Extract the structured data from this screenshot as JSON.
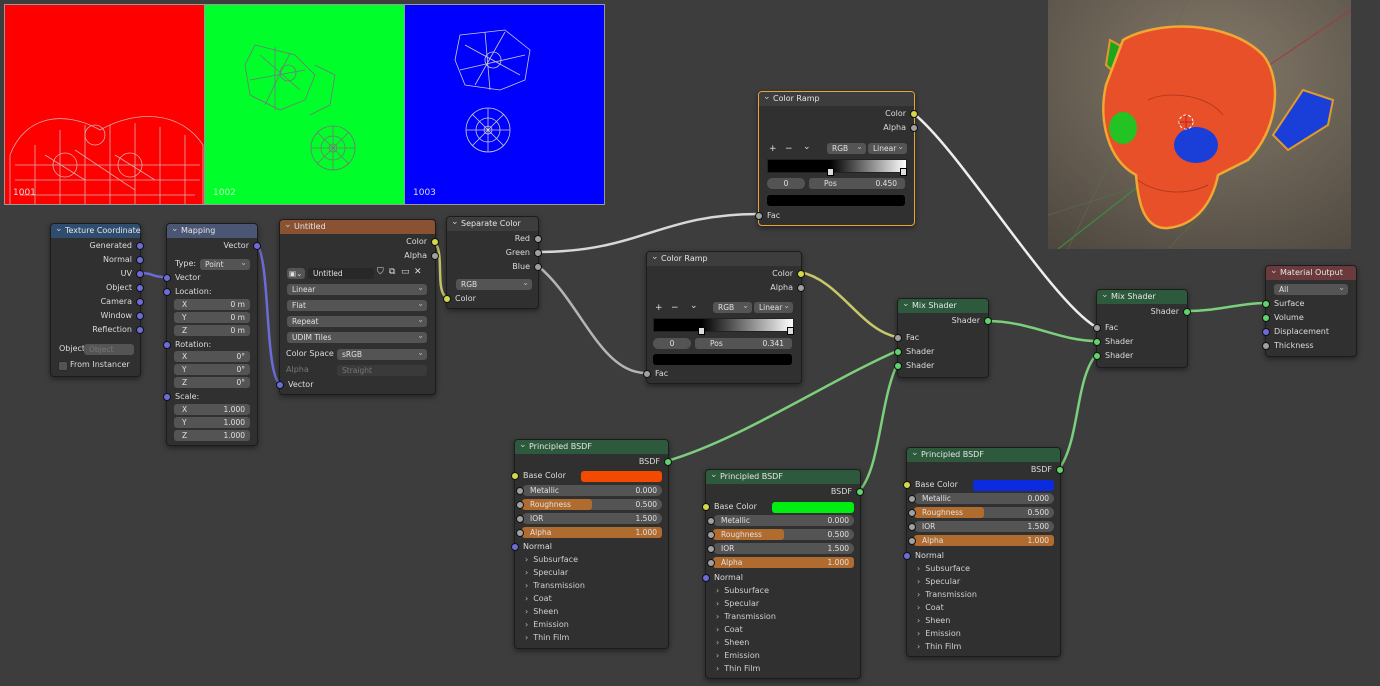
{
  "uv_editor": {
    "tiles": [
      {
        "num": "1001",
        "color": "#ff0000"
      },
      {
        "num": "1002",
        "color": "#00ff2a"
      },
      {
        "num": "1003",
        "color": "#0000ff"
      }
    ]
  },
  "texcoord": {
    "title": "Texture Coordinate",
    "outputs": [
      "Generated",
      "Normal",
      "UV",
      "Object",
      "Camera",
      "Window",
      "Reflection"
    ],
    "object_label": "Object:",
    "object_placeholder": "Object",
    "from_instancer": "From Instancer"
  },
  "mapping": {
    "title": "Mapping",
    "output": "Vector",
    "type_label": "Type:",
    "type_value": "Point",
    "vector_in": "Vector",
    "location_label": "Location:",
    "location": [
      {
        "axis": "X",
        "value": "0 m"
      },
      {
        "axis": "Y",
        "value": "0 m"
      },
      {
        "axis": "Z",
        "value": "0 m"
      }
    ],
    "rotation_label": "Rotation:",
    "rotation": [
      {
        "axis": "X",
        "value": "0°"
      },
      {
        "axis": "Y",
        "value": "0°"
      },
      {
        "axis": "Z",
        "value": "0°"
      }
    ],
    "scale_label": "Scale:",
    "scale": [
      {
        "axis": "X",
        "value": "1.000"
      },
      {
        "axis": "Y",
        "value": "1.000"
      },
      {
        "axis": "Z",
        "value": "1.000"
      }
    ]
  },
  "image_tex": {
    "title": "Untitled",
    "out_color": "Color",
    "out_alpha": "Alpha",
    "image_name": "Untitled",
    "interp": "Linear",
    "projection": "Flat",
    "extension": "Repeat",
    "source": "UDIM Tiles",
    "cs_label": "Color Space",
    "cs_value": "sRGB",
    "alpha_label": "Alpha",
    "alpha_value": "Straight",
    "vector_in": "Vector"
  },
  "separate": {
    "title": "Separate Color",
    "outputs": [
      "Red",
      "Green",
      "Blue"
    ],
    "mode": "RGB",
    "input": "Color"
  },
  "ramp1": {
    "title": "Color Ramp",
    "out_color": "Color",
    "out_alpha": "Alpha",
    "mode": "RGB",
    "interp": "Linear",
    "index": "0",
    "pos_label": "Pos",
    "pos_value": "0.450",
    "input": "Fac",
    "plus": "+",
    "minus": "−",
    "chev": "⌄"
  },
  "ramp2": {
    "title": "Color Ramp",
    "out_color": "Color",
    "out_alpha": "Alpha",
    "mode": "RGB",
    "interp": "Linear",
    "index": "0",
    "pos_label": "Pos",
    "pos_value": "0.341",
    "input": "Fac",
    "plus": "+",
    "minus": "−",
    "chev": "⌄"
  },
  "mix1": {
    "title": "Mix Shader",
    "output": "Shader",
    "inputs": [
      "Fac",
      "Shader",
      "Shader"
    ]
  },
  "mix2": {
    "title": "Mix Shader",
    "output": "Shader",
    "inputs": [
      "Fac",
      "Shader",
      "Shader"
    ]
  },
  "output": {
    "title": "Material Output",
    "target": "All",
    "inputs": [
      "Surface",
      "Volume",
      "Displacement",
      "Thickness"
    ]
  },
  "bsdf1": {
    "title": "Principled BSDF",
    "output": "BSDF",
    "base_color_label": "Base Color",
    "base_color": "#f24a00",
    "metallic_label": "Metallic",
    "metallic": "0.000",
    "roughness_label": "Roughness",
    "roughness": "0.500",
    "ior_label": "IOR",
    "ior": "1.500",
    "alpha_label": "Alpha",
    "alpha": "1.000",
    "normal": "Normal",
    "panels": [
      "Subsurface",
      "Specular",
      "Transmission",
      "Coat",
      "Sheen",
      "Emission",
      "Thin Film"
    ]
  },
  "bsdf2": {
    "title": "Principled BSDF",
    "output": "BSDF",
    "base_color_label": "Base Color",
    "base_color": "#00ee12",
    "metallic_label": "Metallic",
    "metallic": "0.000",
    "roughness_label": "Roughness",
    "roughness": "0.500",
    "ior_label": "IOR",
    "ior": "1.500",
    "alpha_label": "Alpha",
    "alpha": "1.000",
    "normal": "Normal",
    "panels": [
      "Subsurface",
      "Specular",
      "Transmission",
      "Coat",
      "Sheen",
      "Emission",
      "Thin Film"
    ]
  },
  "bsdf3": {
    "title": "Principled BSDF",
    "output": "BSDF",
    "base_color_label": "Base Color",
    "base_color": "#0a2be0",
    "metallic_label": "Metallic",
    "metallic": "0.000",
    "roughness_label": "Roughness",
    "roughness": "0.500",
    "ior_label": "IOR",
    "ior": "1.500",
    "alpha_label": "Alpha",
    "alpha": "1.000",
    "normal": "Normal",
    "panels": [
      "Subsurface",
      "Specular",
      "Transmission",
      "Coat",
      "Sheen",
      "Emission",
      "Thin Film"
    ]
  },
  "colors": {
    "wire_vector": "#6c6cd8",
    "wire_color": "#c8c86a",
    "wire_gray": "#b5b5b5",
    "wire_shader": "#7ccf7c",
    "selected": "#e8a33a"
  }
}
